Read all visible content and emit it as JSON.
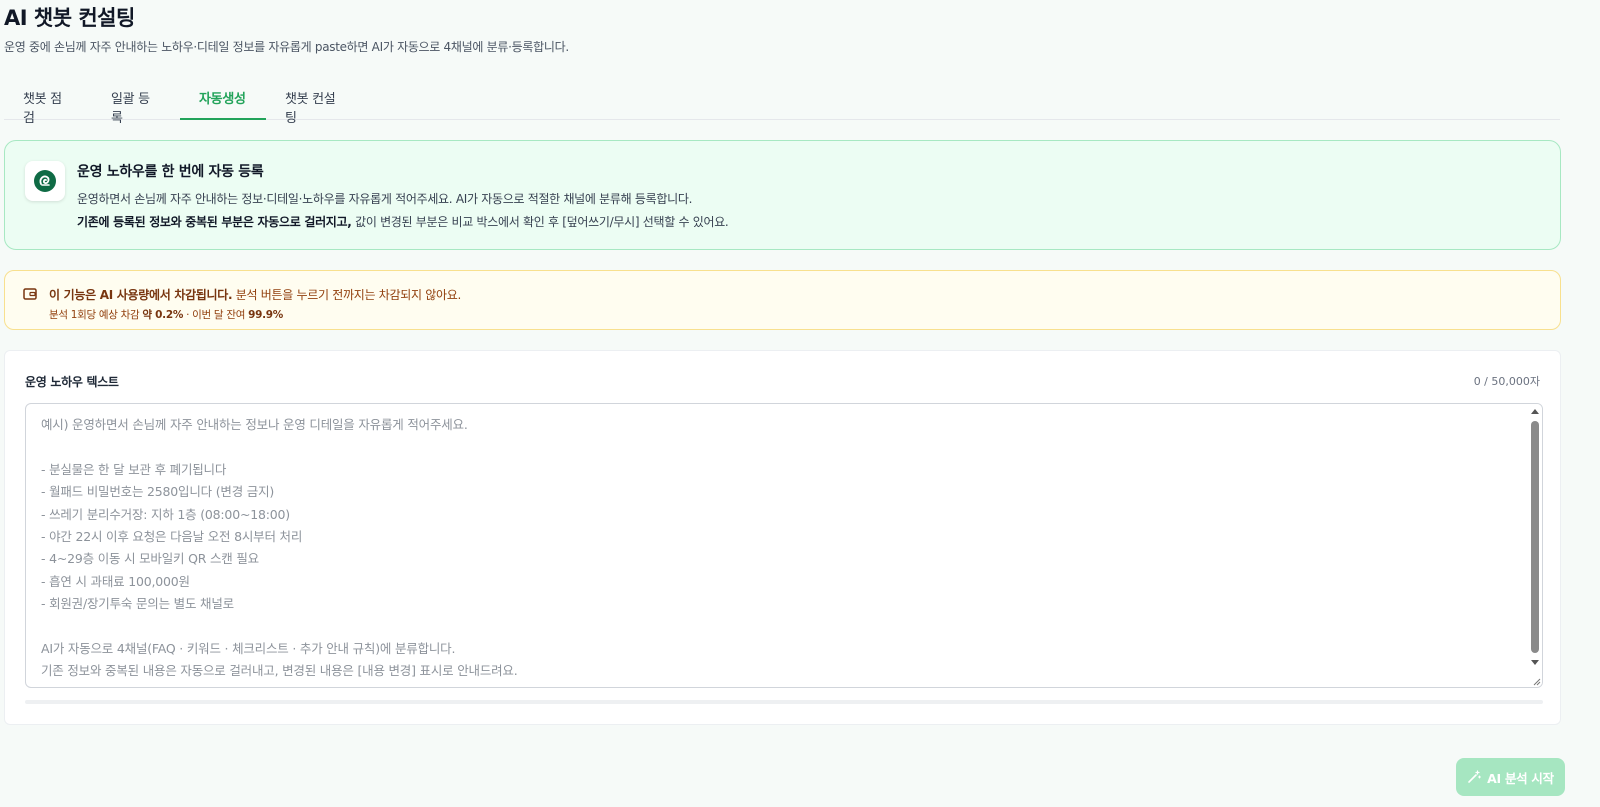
{
  "header": {
    "title": "AI 챗봇 컨설팅",
    "subtitle": "운영 중에 손님께 자주 안내하는 노하우·디테일 정보를 자유롭게 paste하면 AI가 자동으로 4채널에 분류·등록합니다."
  },
  "tabs": [
    {
      "label": "챗봇 점검",
      "active": false
    },
    {
      "label": "일괄 등록",
      "active": false
    },
    {
      "label": "자동생성",
      "active": true
    },
    {
      "label": "챗봇 컨설팅",
      "active": false
    }
  ],
  "info": {
    "icon": "ai-swirl-icon",
    "title": "운영 노하우를 한 번에 자동 등록",
    "desc1": "운영하면서 손님께 자주 안내하는 정보·디테일·노하우를 자유롭게 적어주세요. AI가 자동으로 적절한 채널에 분류해 등록합니다.",
    "desc2_bold": "기존에 등록된 정보와 중복된 부분은 자동으로 걸러지고,",
    "desc2_rest": " 값이 변경된 부분은 비교 박스에서 확인 후 [덮어쓰기/무시] 선택할 수 있어요."
  },
  "usage": {
    "icon": "wallet-icon",
    "line1_bold": "이 기능은 AI 사용량에서 차감됩니다.",
    "line1_rest": " 분석 버튼을 누르기 전까지는 차감되지 않아요.",
    "line2_prefix": "분석 1회당 예상 차감 ",
    "line2_value1": "약 0.2%",
    "line2_mid": " · 이번 달 잔여 ",
    "line2_value2": "99.9%"
  },
  "input": {
    "label": "운영 노하우 텍스트",
    "char_count": "0 / 50,000자",
    "placeholder": "예시) 운영하면서 손님께 자주 안내하는 정보나 운영 디테일을 자유롭게 적어주세요.\n\n- 분실물은 한 달 보관 후 폐기됩니다\n- 월패드 비밀번호는 2580입니다 (변경 금지)\n- 쓰레기 분리수거장: 지하 1층 (08:00~18:00)\n- 야간 22시 이후 요청은 다음날 오전 8시부터 처리\n- 4~29층 이동 시 모바일키 QR 스캔 필요\n- 흡연 시 과태료 100,000원\n- 회원권/장기투숙 문의는 별도 채널로\n\nAI가 자동으로 4채널(FAQ · 키워드 · 체크리스트 · 추가 안내 규칙)에 분류합니다.\n기존 정보와 중복된 내용은 자동으로 걸러내고, 변경된 내용은 [내용 변경] 표시로 안내드려요.",
    "progress": 0
  },
  "actions": {
    "analyze_label": "AI 분석 시작",
    "analyze_icon": "magic-wand-icon"
  },
  "colors": {
    "accent": "#22a35a",
    "info_bg": "#ecfdf3",
    "warn_bg": "#fffdf0"
  }
}
